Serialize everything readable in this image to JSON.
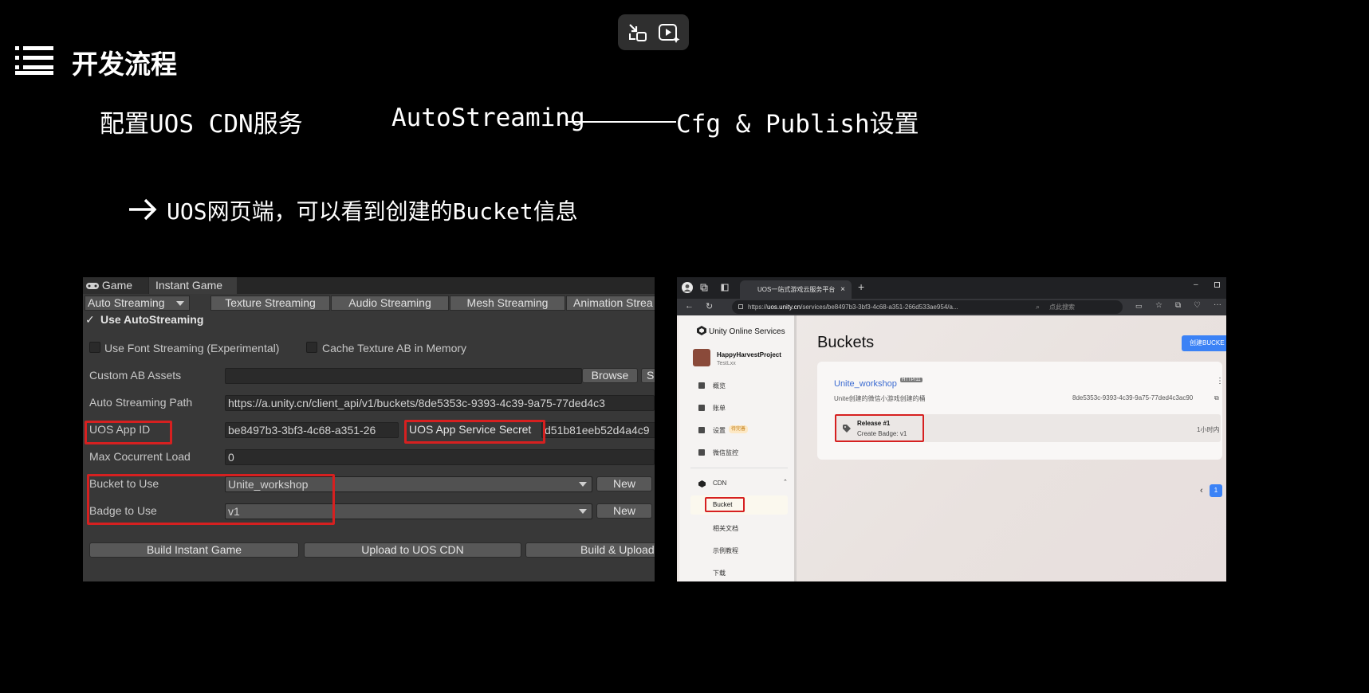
{
  "slide": {
    "title": "开发流程",
    "subtitle_left": "配置UOS CDN服务",
    "subtitle_mid": "AutoStreaming",
    "subtitle_right": "Cfg & Publish设置",
    "bullet": "UOS网页端，可以看到创建的Bucket信息"
  },
  "unity": {
    "tabs": [
      "Game",
      "Instant Game"
    ],
    "mode_dropdown": "Auto Streaming",
    "streaming_tabs": [
      "Texture Streaming",
      "Audio Streaming",
      "Mesh Streaming",
      "Animation Strea"
    ],
    "use_autostreaming": "Use AutoStreaming",
    "use_font_streaming": "Use Font Streaming (Experimental)",
    "cache_texture": "Cache Texture AB in Memory",
    "custom_ab_label": "Custom AB Assets",
    "browse": "Browse",
    "browse2": "S",
    "auto_path_label": "Auto Streaming Path",
    "auto_path_value": "https://a.unity.cn/client_api/v1/buckets/8de5353c-9393-4c39-9a75-77ded4c3",
    "app_id_label": "UOS App ID",
    "app_id_value": "be8497b3-3bf3-4c68-a351-26",
    "secret_label": "UOS App Service Secret",
    "secret_value": "d51b81eeb52d4a4c9",
    "max_load_label": "Max Cocurrent Load",
    "max_load_value": "0",
    "bucket_label": "Bucket to Use",
    "bucket_value": "Unite_workshop",
    "badge_label": "Badge to Use",
    "badge_value": "v1",
    "new_label": "New",
    "build_instant": "Build Instant Game",
    "upload_cdn": "Upload to UOS CDN",
    "build_upload": "Build & Upload"
  },
  "browser": {
    "tab_title": "UOS一站式游戏云服务平台",
    "url_prefix": "https://",
    "url_host": "uos.unity.cn",
    "url_path": "/services/be8497b3-3bf3-4c68-a351-266d533ae954/a...",
    "search_placeholder": "点此搜索",
    "brand": "Unity Online Services",
    "project_name": "HappyHarvestProject",
    "project_user": "TestLxx",
    "nav": [
      "概览",
      "账单",
      "设置",
      "微信监控"
    ],
    "settings_badge": "待完善",
    "cdn": "CDN",
    "bucket_nav": "Bucket",
    "sub_nav": [
      "相关文档",
      "示例教程",
      "下载"
    ],
    "page_title": "Buckets",
    "create_button": "创建BUCKE",
    "bucket_name": "Unite_workshop",
    "bucket_tag": "HTTP/11",
    "bucket_desc": "Unite创建的微信小游戏创建的桶",
    "bucket_id": "8de5353c-9393-4c39-9a75-77ded4c3ac90",
    "release_title": "Release #1",
    "release_badge": "Create Badge: v1",
    "release_time": "1小时内",
    "page_number": "1"
  }
}
